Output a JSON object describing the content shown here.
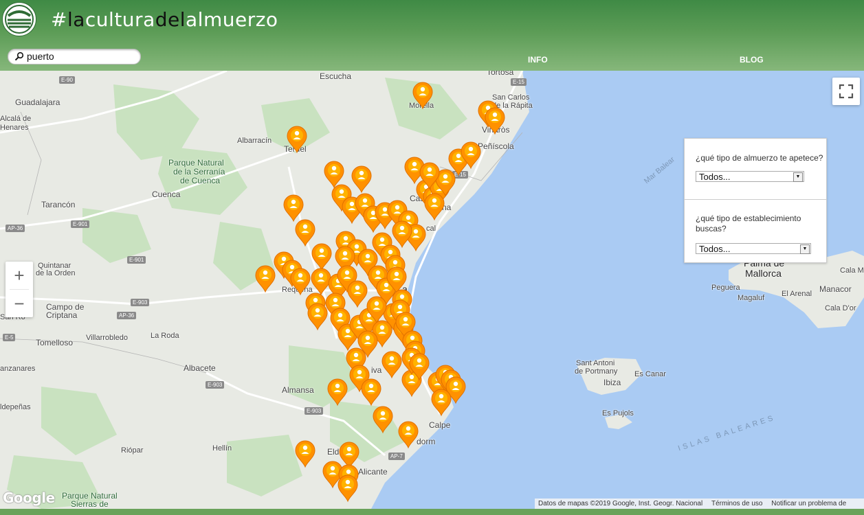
{
  "header": {
    "brand_parts": [
      "#",
      "la",
      "cultura",
      "del",
      "almuerzo"
    ],
    "nav": {
      "info": "INFO",
      "blog": "BLOG"
    }
  },
  "search": {
    "value": "puerto",
    "icon": "search-icon"
  },
  "filters": {
    "q1": "¿qué tipo de almuerzo te apetece?",
    "q1_selected": "Todos...",
    "q2": "¿qué tipo de establecimiento buscas?",
    "q2_selected": "Todos..."
  },
  "map": {
    "zoom_in": "+",
    "zoom_out": "−",
    "fullscreen_icon": "fullscreen-icon",
    "logo": "Google",
    "attribution": [
      "Datos de mapas ©2019 Google, Inst. Geogr. Nacional",
      "Términos de uso",
      "Notificar un problema de Maps"
    ],
    "places": {
      "escucha": "Escucha",
      "tortosa": "Tortosa",
      "san_carlos": "San Carlos",
      "de_la_rapita": "de la Rápita",
      "guadalajara": "Guadalajara",
      "morella": "Morella",
      "alcala": "Alcalá de",
      "henares": "Henares",
      "vinaros": "Vinaròs",
      "albarracin": "Albarracín",
      "teruel": "Teruel",
      "peniscola": "Peñíscola",
      "park1_l1": "Parque Natural",
      "park1_l2": "de la Serranía",
      "park1_l3": "de Cuenca",
      "cuenca": "Cuenca",
      "tarancon": "Tarancón",
      "castellon_frag": "Cas",
      "castellon_frag2": "na",
      "sagunto_frag": "cal",
      "quintanar_l1": "Quintanar",
      "quintanar_l2": "de la Orden",
      "requena": "Requena",
      "valencia_frag": "a",
      "campo_l1": "Campo de",
      "campo_l2": "Criptana",
      "sarro_frag": "San Ro",
      "tomelloso": "Tomelloso",
      "villarrobledo": "Villarrobledo",
      "la_roda": "La Roda",
      "albacete": "Albacete",
      "manzanares_frag": "anzanares",
      "almansa": "Almansa",
      "valdepenas_frag": "ldepeñas",
      "xativa_frag": "iva",
      "calpe": "Calpe",
      "benidorm_frag": "dorm",
      "riopar": "Riópar",
      "hellin": "Hellín",
      "elda_frag": "Eld",
      "alicante": "Alicante",
      "park2_l1": "Parque Natural",
      "park2_l2": "Sierras de",
      "palma_l1": "Palma de",
      "palma_l2": "Mallorca",
      "mar_balear": "Mar Balear",
      "cala_mi": "Cala Mi",
      "peguera": "Peguera",
      "magaluf": "Magaluf",
      "el_arenal": "El Arenal",
      "manacor": "Manacor",
      "cala_dor": "Cala D'or",
      "sant_antoni_l1": "Sant Antoni",
      "sant_antoni_l2": "de Portmany",
      "ibiza": "Ibiza",
      "es_canar": "Es Canar",
      "es_pujols": "Es Pujols",
      "islas_baleares": "ISLAS BALEARES"
    },
    "roads": [
      "E-90",
      "E-15",
      "AP-36",
      "E-901",
      "E-901",
      "E-903",
      "AP-36",
      "E-5",
      "E-903",
      "E-903",
      "E-15",
      "AP-7"
    ],
    "marker_icon": "person-pin-icon",
    "markers_count_hint": "many"
  },
  "colors": {
    "header": "#4f9450",
    "sea": "#aacbf3",
    "land": "#e8eae4",
    "pin": "#ff9800"
  }
}
